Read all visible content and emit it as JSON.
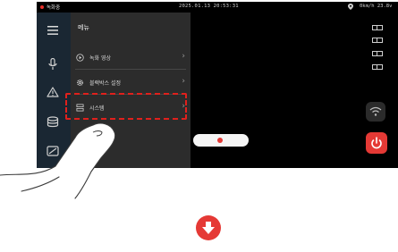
{
  "status_bar": {
    "recording_label": "녹화중",
    "datetime": "2025.01.13 20:53:31",
    "speed": "0km/h 23.8v"
  },
  "sidebar": {
    "icons": [
      "menu-icon",
      "microphone-icon",
      "warning-icon",
      "database-icon",
      "card-icon"
    ]
  },
  "menu": {
    "title": "메뉴",
    "items": [
      {
        "label": "녹화 영상",
        "icon": "play-circle-icon"
      },
      {
        "label": "블랙박스 설정",
        "icon": "gear-icon"
      },
      {
        "label": "시스템",
        "icon": "system-icon"
      }
    ]
  },
  "right_panel": {
    "view_buttons": [
      "view-mode-1",
      "view-mode-2",
      "view-mode-3",
      "view-mode-4"
    ]
  },
  "colors": {
    "accent_red": "#E53935",
    "rail_bg": "#1A2733",
    "panel_bg": "#2C2C2C"
  }
}
